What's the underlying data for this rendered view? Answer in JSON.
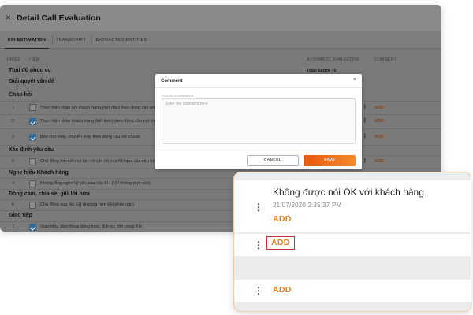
{
  "window": {
    "title": "Detail Call Evaluation",
    "close_icon": "×"
  },
  "tabs": [
    {
      "label": "KPI ESTIMATION",
      "active": true
    },
    {
      "label": "TRANSCRIPT",
      "active": false
    },
    {
      "label": "EXTRACTED ENTITIES",
      "active": false
    }
  ],
  "columns": {
    "index": "INDEX",
    "item": "ITEM",
    "auto_eval": "AUTOMATIC EVALUATION",
    "comment": "COMMENT"
  },
  "rows": [
    {
      "type": "group",
      "label": "Thái độ phục vụ",
      "total_score": "Total Score : 0"
    },
    {
      "type": "group",
      "label": "Giải quyết vấn đề"
    },
    {
      "type": "group",
      "label": "Chào hỏi"
    },
    {
      "type": "item",
      "index": "1",
      "checked": false,
      "text": "Thực hiện chào hỏi khách hàng (mở đầu) theo đúng câu nói chuẩn",
      "separator": "|",
      "add": "ADD"
    },
    {
      "type": "item",
      "index": "2",
      "checked": true,
      "text": "Thực hiện chào khách hàng (kết thúc) theo đúng câu nói chuẩn",
      "separator": "|",
      "add": "ADD"
    },
    {
      "type": "item",
      "index": "3",
      "checked": true,
      "text": "Báo chờ máy, chuyển máy theo đúng câu nói chuẩn",
      "separator": "|",
      "add": "ADD"
    },
    {
      "type": "group",
      "label": "Xác định yêu cầu"
    },
    {
      "type": "item",
      "index": "5",
      "checked": false,
      "text": "Chủ động tìm hiểu và làm rõ vấn đề của KH qua các câu hỏi phù hợp",
      "separator": "|",
      "add": "ADD"
    },
    {
      "type": "group",
      "label": "Nghe hiểu Khách hàng"
    },
    {
      "type": "item",
      "index": "4",
      "checked": false,
      "text": "Không lắng nghe kỹ yêu cầu của KH (KH không bực xúc)"
    },
    {
      "type": "group",
      "label": "Đồng cảm, chia sẻ, giữ lời hứa"
    },
    {
      "type": "item",
      "index": "6",
      "checked": false,
      "text": "Chủ động xoa dịu KH (trường hợp KH phàn nàn)"
    },
    {
      "type": "group",
      "label": "Giao tiếp"
    },
    {
      "type": "item",
      "index": "7",
      "checked": true,
      "text": "Giao tiếp, đàm thoại đúng mực, lịch sự, tôn trọng KH"
    }
  ],
  "modal": {
    "title": "Comment",
    "close_icon": "×",
    "field_label": "YOUR COMMENT",
    "placeholder": "Enter the comment here",
    "cancel_label": "CANCEL",
    "save_label": "SAVE"
  },
  "zoom": {
    "comment_text": "Không được nói OK với khách hàng",
    "comment_time": "21/07/2020 2:35:37 PM",
    "menu_icon": "⋮",
    "add_1": "ADD",
    "add_2": "ADD",
    "add_3": "ADD"
  },
  "colors": {
    "accent_orange": "#ef7d1a",
    "save_gradient_start": "#e8590c",
    "checkbox_blue": "#2d6da0",
    "highlight_red": "#c9302c"
  }
}
